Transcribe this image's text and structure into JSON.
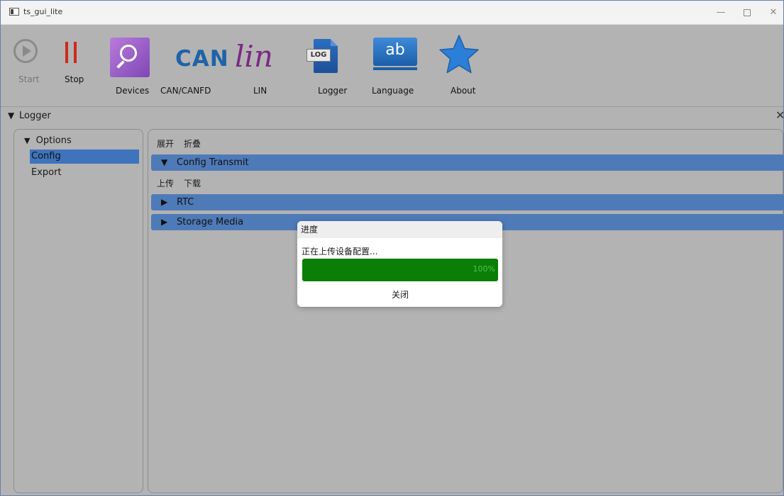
{
  "window": {
    "title": "ts_gui_lite",
    "minimize": "—",
    "close": "✕"
  },
  "toolbar": {
    "start_label": "Start",
    "stop_label": "Stop",
    "devices_label": "Devices",
    "can_label": "CAN/CANFD",
    "can_logo_text": "CAN",
    "lin_label": "LIN",
    "lin_logo_text": "lin",
    "logger_label": "Logger",
    "logger_tag_text": "LOG",
    "language_label": "Language",
    "language_logo_text": "ab",
    "about_label": "About",
    "icons": {
      "start": "play-circle-icon",
      "stop": "pause-bars-icon",
      "devices": "magnifier-icon",
      "can": "can-logo-icon",
      "lin": "lin-logo-icon",
      "logger": "log-document-icon",
      "language": "ab-text-icon",
      "about": "star-icon"
    }
  },
  "panel": {
    "title": "Logger",
    "expand_arrow": "▼",
    "close": "✕"
  },
  "sidebar": {
    "root_arrow": "▼",
    "root_label": "Options",
    "items": [
      {
        "label": "Config",
        "selected": true
      },
      {
        "label": "Export",
        "selected": false
      }
    ]
  },
  "main": {
    "expand_label": "展开",
    "collapse_label": "折叠",
    "sections": [
      {
        "arrow": "▼",
        "label": "Config Transmit"
      },
      {
        "arrow": "▶",
        "label": "RTC"
      },
      {
        "arrow": "▶",
        "label": "Storage Media"
      }
    ],
    "upload_label": "上传",
    "download_label": "下载"
  },
  "dialog": {
    "title": "进度",
    "message": "正在上传设备配置...",
    "progress_percent": 100,
    "progress_text": "100%",
    "close_label": "关闭"
  },
  "colors": {
    "selection": "#3f74bc",
    "section_header": "#4f7ab8",
    "progress_fill": "#0a7e07",
    "stop_red": "#cc2a1e",
    "can_blue": "#1f63a8",
    "lin_purple": "#7a2a83",
    "star_blue": "#2b7fd6"
  }
}
